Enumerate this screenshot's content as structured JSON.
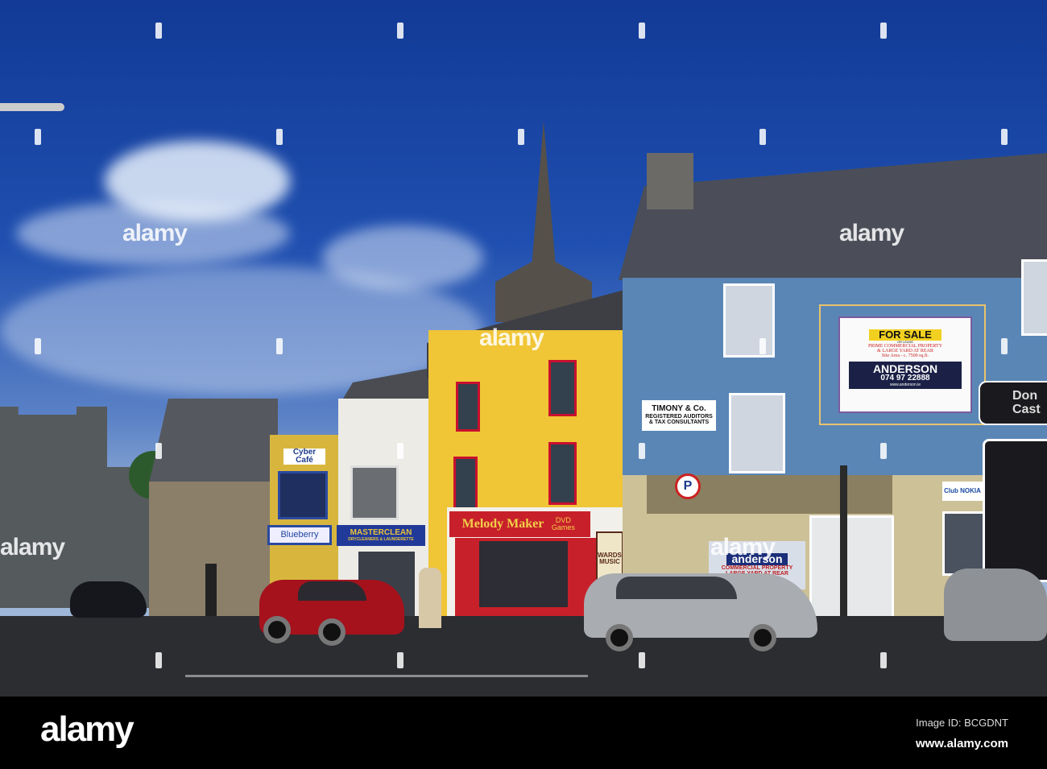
{
  "watermark": {
    "brand": "alamy",
    "image_id": "Image ID: BCGDNT",
    "url": "www.alamy.com"
  },
  "signs": {
    "cyber_cafe": "Cyber Café",
    "blueberry": "Blueberry",
    "masterclean": "MASTERCLEAN",
    "masterclean_sub": "DRYCLEANERS & LAUNDERETTE",
    "melody_maker": "Melody Maker",
    "melody_dvd": "DVD Games",
    "wards": "WARDS MUSIC",
    "timony_1": "TIMONY & Co.",
    "timony_2": "REGISTERED AUDITORS",
    "timony_3": "& TAX CONSULTANTS",
    "for_sale": "FOR SALE",
    "or_lease": "OR LEASE",
    "prime": "PRIME COMMERCIAL PROPERTY",
    "yard": "& LARGE YARD AT REAR",
    "site_area": "Site Area - c. 7500 sq.ft.",
    "anderson": "ANDERSON",
    "phone": "074 97 22888",
    "anderson_url": "www.anderson.ie",
    "road_sign_1": "Don",
    "road_sign_2": "Cast",
    "club_nokia": "Club NOKIA",
    "window_anderson": "anderson",
    "window_commercial": "COMMERCIAL PROPERTY",
    "window_yard": "LARGE YARD AT REAR",
    "parking": "P"
  }
}
